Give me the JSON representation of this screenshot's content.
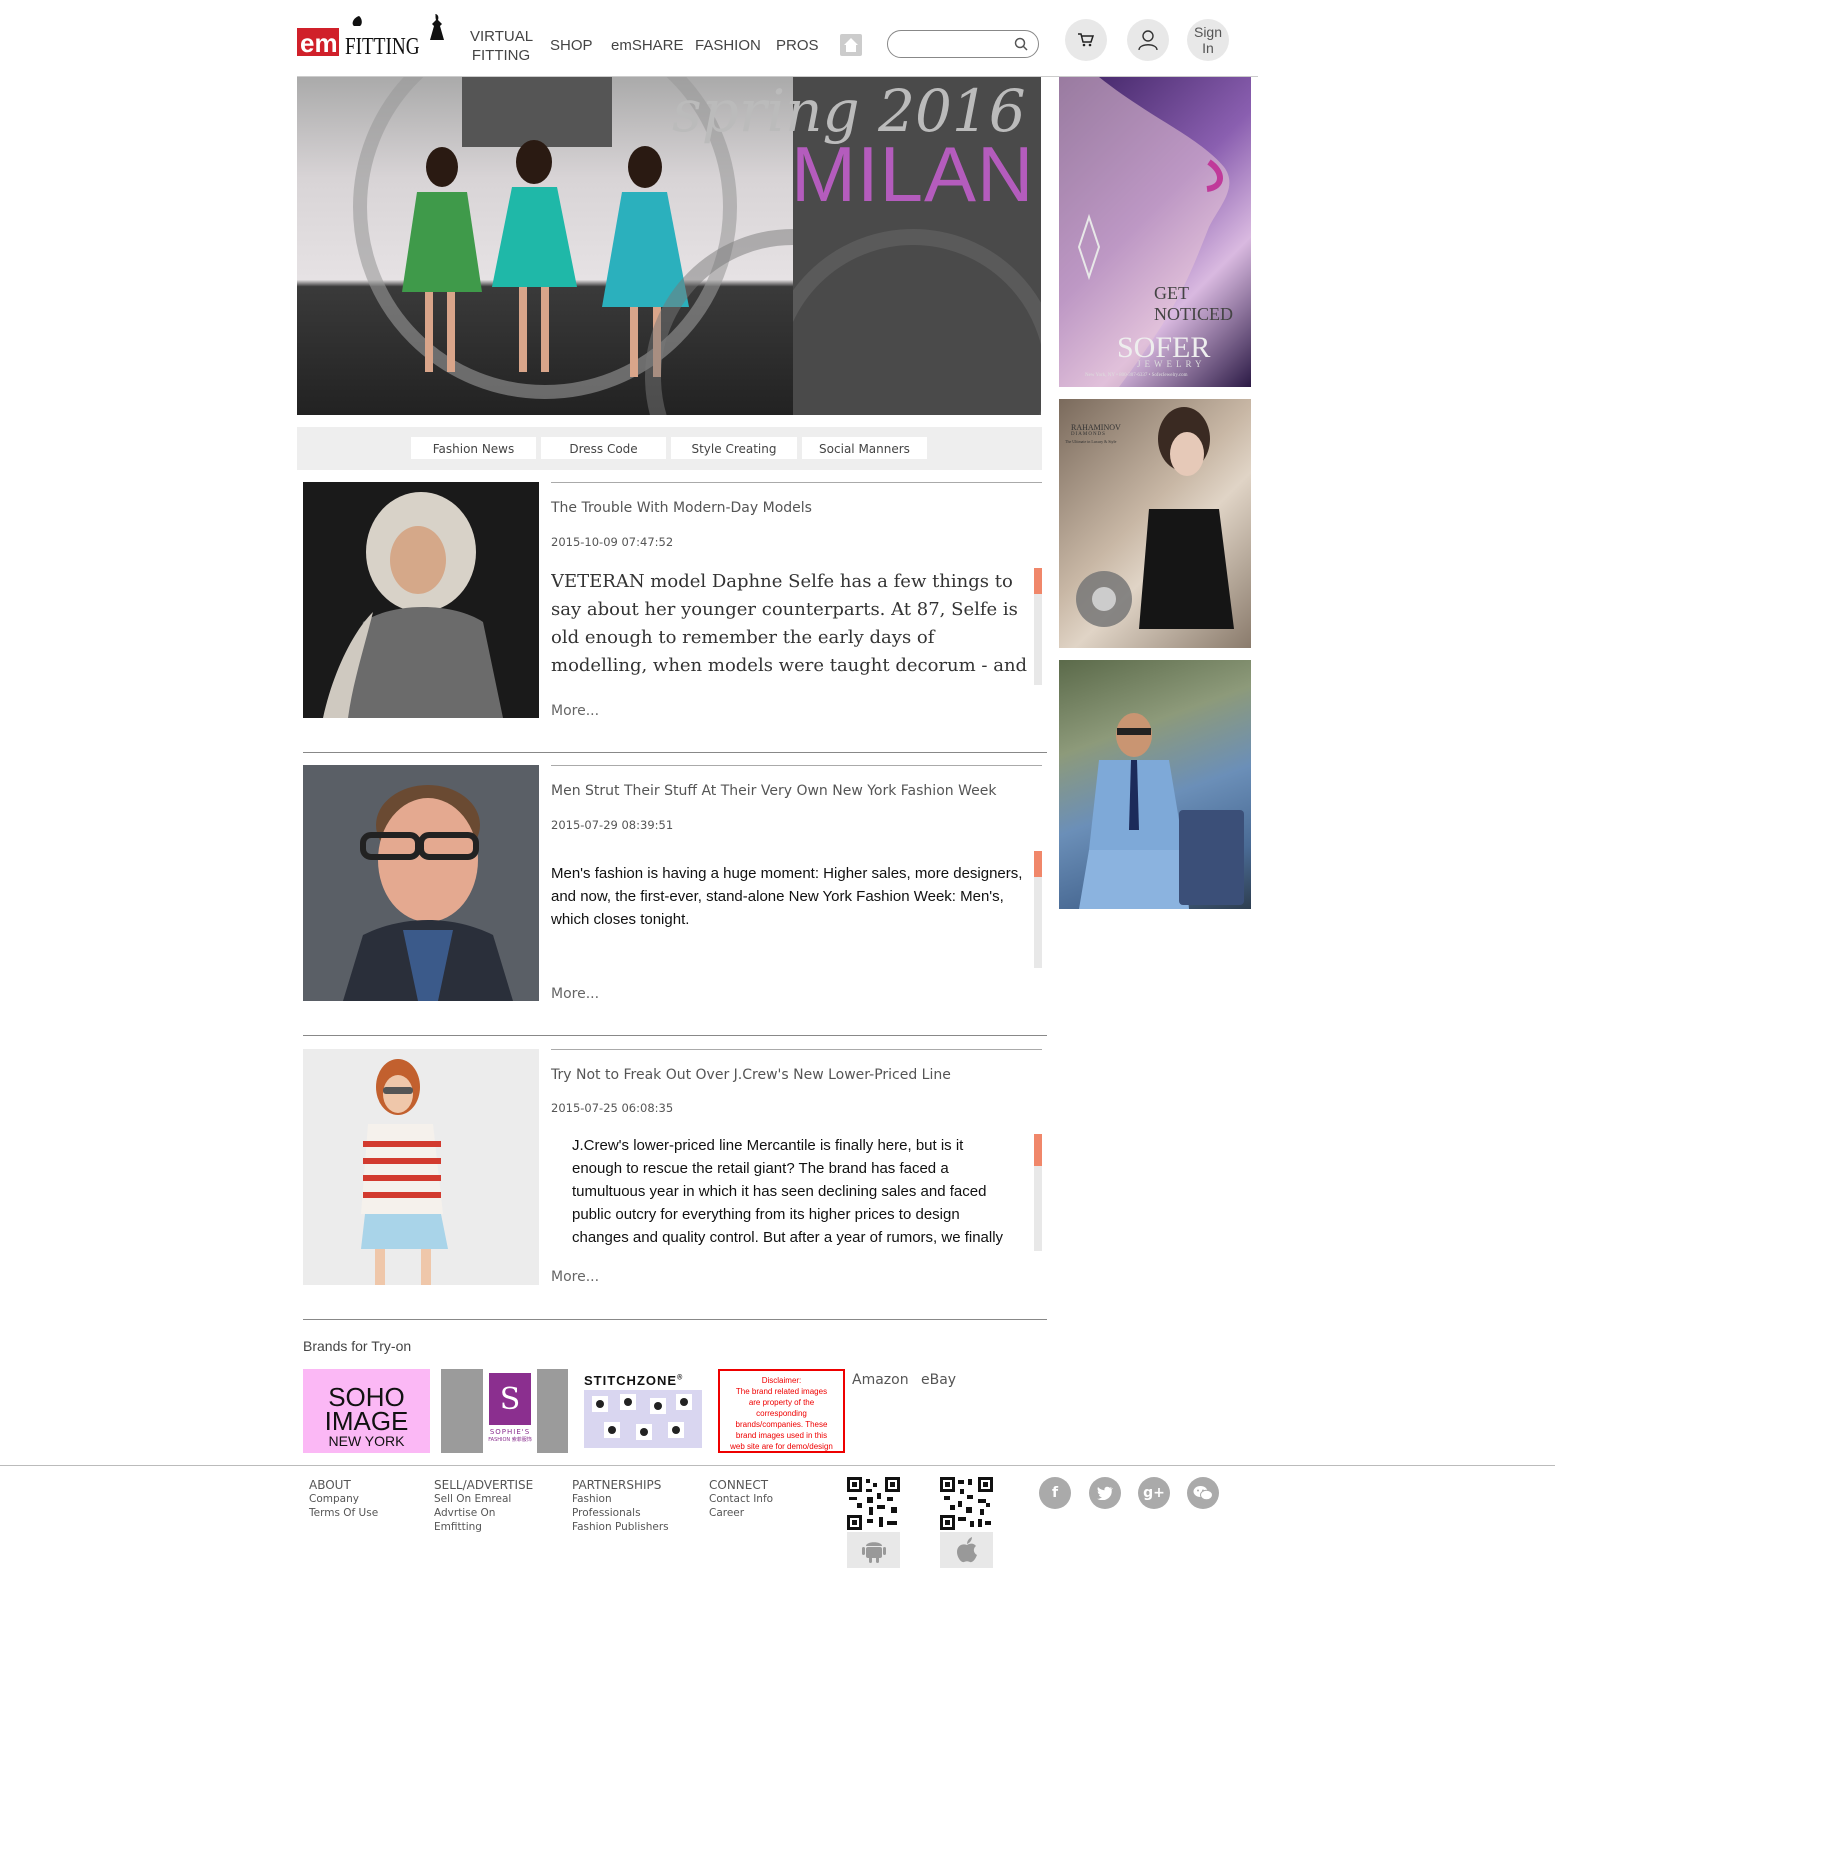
{
  "header": {
    "logo_text_em": "em",
    "logo_text_fitting": "FITTING",
    "nav": [
      "VIRTUAL",
      "FITTING",
      "SHOP",
      "emSHARE",
      "FASHION",
      "PROS"
    ],
    "search_placeholder": "",
    "sign_in": [
      "Sign",
      "In"
    ]
  },
  "banner": {
    "season": "spring 2016",
    "city": "MILAN",
    "city_color": "#b45cbd"
  },
  "ads": {
    "ad1_tagline": "GET NOTICED",
    "ad1_brand": "SOFER",
    "ad1_sub": "JEWELRY",
    "ad1_address": "New York, NY • 800-307-6337 • SoferJewelry.com",
    "ad2_brand": "RAHAMINOV",
    "ad2_sub": "DIAMONDS",
    "ad2_tagline": "The Ultimate in Luxury & Style"
  },
  "tabs": [
    "Fashion News",
    "Dress Code",
    "Style Creating",
    "Social Manners"
  ],
  "articles": [
    {
      "title": "The Trouble With Modern-Day Models",
      "date": "2015-10-09 07:47:52",
      "body": "VETERAN model Daphne Selfe has a few things to say about her younger counterparts. At 87, Selfe is old enough to remember the early days of modelling, when models were taught decorum - and you had to bring your own hair and make-up kit.",
      "more": "More..."
    },
    {
      "title": "Men Strut Their Stuff At Their Very Own New York Fashion Week",
      "date": "2015-07-29 08:39:51",
      "body": "Men's fashion is having a huge moment: Higher sales, more designers, and now, the first-ever, stand-alone New York Fashion Week: Men's, which closes tonight.",
      "more": "More..."
    },
    {
      "title": "Try Not to Freak Out Over J.Crew's New Lower-Priced Line",
      "date": "2015-07-25 06:08:35",
      "body": "J.Crew's lower-priced line Mercantile is finally here, but is it enough to rescue the retail giant? The brand has faced a tumultuous year in which it has seen declining sales and faced public outcry for everything from its higher prices to design changes and quality control. But after a year of rumors, we finally have a look at the new line.",
      "more": "More..."
    }
  ],
  "brands": {
    "title": "Brands for Try-on",
    "soho": [
      "SOHO",
      "IMAGE",
      "NEW YORK"
    ],
    "sophies": "SOPHIE'S",
    "sophies_sub": "FASHION 索菲服饰",
    "stitchzone": "STITCHZONE",
    "stitchzone_mark": "®",
    "disclaimer_title": "Disclaimer:",
    "disclaimer": "The brand related images are property of the corresponding brands/companies. These brand images used in this web site are for demo/design draft only.",
    "amazon": "Amazon",
    "ebay": "eBay"
  },
  "footer": {
    "about": {
      "head": "ABOUT",
      "links": [
        "Company",
        "Terms Of Use"
      ]
    },
    "sell": {
      "head": "SELL/ADVERTISE",
      "links": [
        "Sell On Emreal",
        "Advrtise On",
        "Emfitting"
      ]
    },
    "partners": {
      "head": "PARTNERSHIPS",
      "links": [
        "Fashion",
        "Professionals",
        "Fashion Publishers"
      ]
    },
    "connect": {
      "head": "CONNECT",
      "links": [
        "Contact Info",
        "Career"
      ]
    },
    "social": [
      "f",
      "t",
      "g+",
      "w"
    ]
  }
}
